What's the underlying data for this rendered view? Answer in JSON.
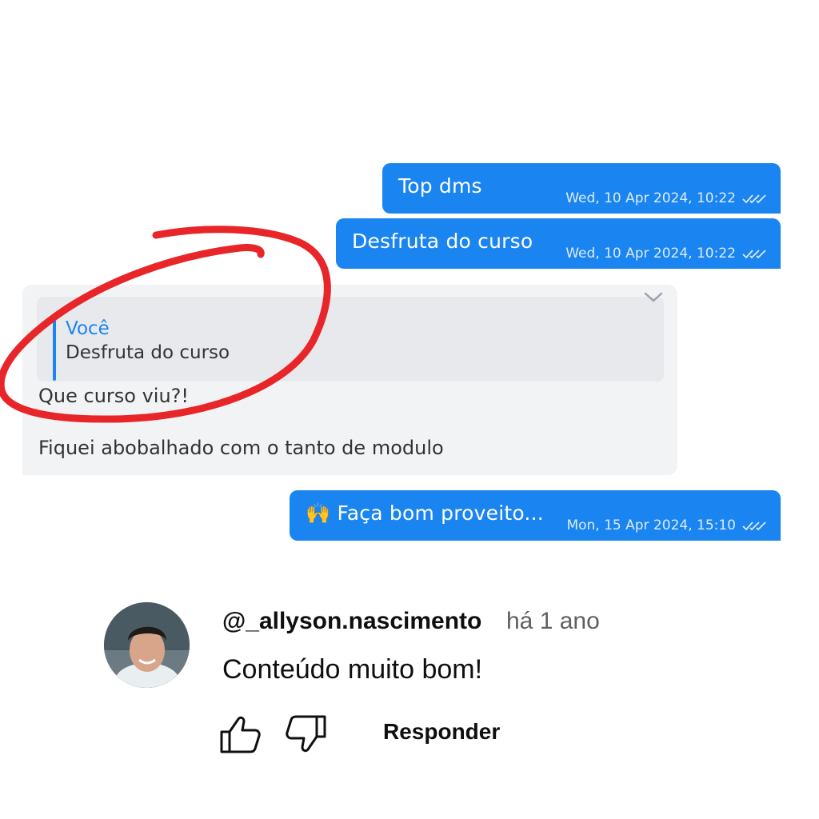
{
  "chat": {
    "messages": [
      {
        "text": "Top dms",
        "time": "Wed, 10 Apr 2024, 10:22"
      },
      {
        "text": "Desfruta do curso",
        "time": "Wed, 10 Apr 2024, 10:22"
      },
      {
        "text": "🙌 Faça bom proveito...",
        "time": "Mon, 15 Apr 2024, 15:10"
      }
    ],
    "incoming": {
      "quote_author": "Você",
      "quote_text": "Desfruta do curso",
      "line1": "Que curso viu?!",
      "line2": "Fiquei abobalhado com o tanto de modulo"
    },
    "colors": {
      "outgoing": "#1a85f0",
      "incoming": "#f2f3f5",
      "highlight_circle": "#e8262a"
    }
  },
  "comment": {
    "handle": "@_allyson.nascimento",
    "time_ago": "há 1 ano",
    "text": "Conteúdo muito bom!",
    "reply_label": "Responder",
    "icons": [
      "thumbs-up-icon",
      "thumbs-down-icon"
    ]
  }
}
